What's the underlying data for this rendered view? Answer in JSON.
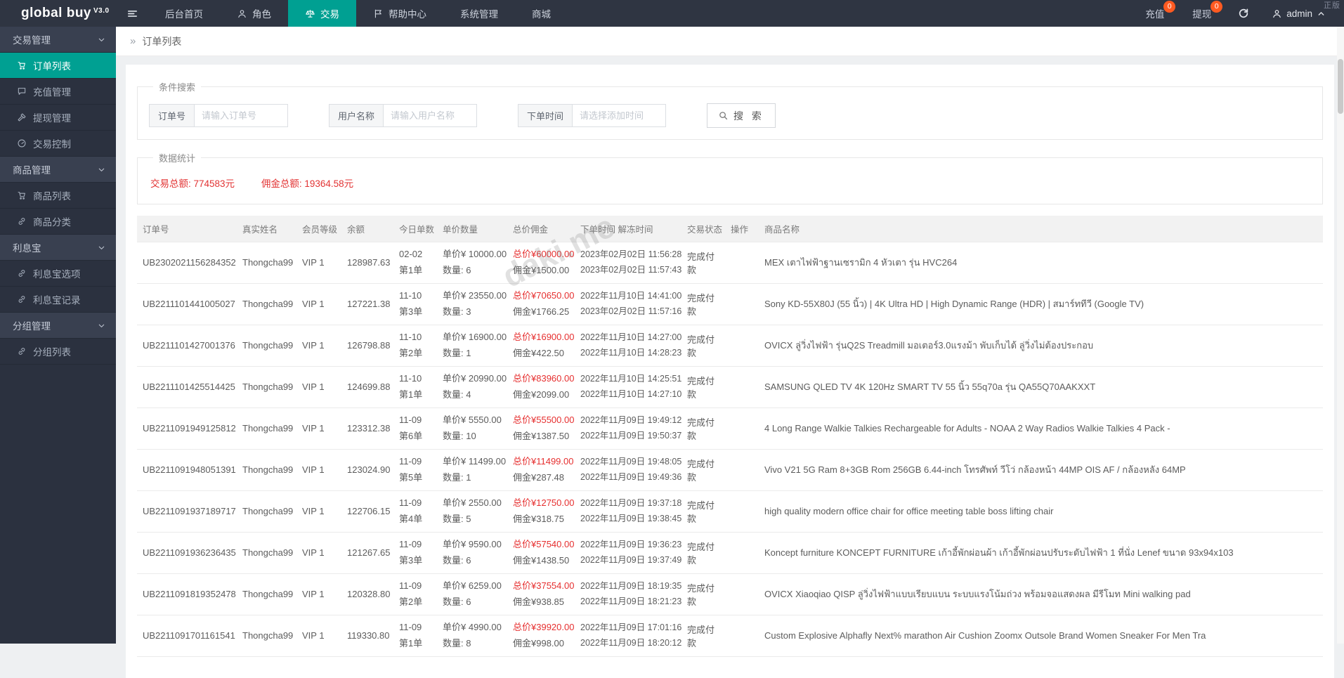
{
  "navbar": {
    "logo": "global buy",
    "logo_version": "V3.0",
    "menu": [
      {
        "label": "后台首页",
        "icon": null,
        "active": false
      },
      {
        "label": "角色",
        "icon": "person",
        "active": false
      },
      {
        "label": "交易",
        "icon": "scales",
        "active": true
      },
      {
        "label": "帮助中心",
        "icon": "flag",
        "active": false
      },
      {
        "label": "系统管理",
        "icon": null,
        "active": false
      },
      {
        "label": "商城",
        "icon": null,
        "active": false
      }
    ],
    "right": {
      "recharge_label": "充值",
      "recharge_badge": "0",
      "withdraw_label": "提现",
      "withdraw_badge": "0",
      "user": "admin",
      "corner_tag": "正版"
    }
  },
  "sidebar": {
    "groups": [
      {
        "label": "交易管理",
        "items": [
          {
            "label": "订单列表",
            "icon": "cart",
            "active": true
          },
          {
            "label": "充值管理",
            "icon": "comment",
            "active": false
          },
          {
            "label": "提现管理",
            "icon": "gavel",
            "active": false
          },
          {
            "label": "交易控制",
            "icon": "gauge",
            "active": false
          }
        ]
      },
      {
        "label": "商品管理",
        "items": [
          {
            "label": "商品列表",
            "icon": "cart",
            "active": false
          },
          {
            "label": "商品分类",
            "icon": "link",
            "active": false
          }
        ]
      },
      {
        "label": "利息宝",
        "items": [
          {
            "label": "利息宝选项",
            "icon": "link",
            "active": false
          },
          {
            "label": "利息宝记录",
            "icon": "link",
            "active": false
          }
        ]
      },
      {
        "label": "分组管理",
        "items": [
          {
            "label": "分组列表",
            "icon": "link",
            "active": false
          }
        ]
      }
    ]
  },
  "breadcrumb": {
    "title": "订单列表"
  },
  "search": {
    "legend": "条件搜索",
    "fields": [
      {
        "label": "订单号",
        "placeholder": "请输入订单号"
      },
      {
        "label": "用户名称",
        "placeholder": "请输入用户名称"
      },
      {
        "label": "下单时间",
        "placeholder": "请选择添加时间"
      }
    ],
    "button": "搜 索"
  },
  "stats": {
    "legend": "数据统计",
    "total_trade": "交易总额: 774583元",
    "total_commission": "佣金总额: 19364.58元"
  },
  "watermark": "daki.me",
  "table": {
    "headers": [
      "订单号",
      "真实姓名",
      "会员等级",
      "余额",
      "今日单数",
      "单价数量",
      "总价佣金",
      "下单时间 解冻时间",
      "交易状态",
      "操作",
      "商品名称"
    ],
    "rows": [
      {
        "order_no": "UB2302021156284352",
        "real_name": "Thongcha99",
        "vip": "VIP 1",
        "balance": "128987.63",
        "day": "02-02",
        "seq": "第1单",
        "unit_price": "单价¥ 10000.00",
        "quantity": "数量: 6",
        "total": "总价¥60000.00",
        "commission": "佣金¥1500.00",
        "order_time": "2023年02月02日 11:56:28",
        "unfreeze_time": "2023年02月02日 11:57:43",
        "status": "完成付款",
        "product": "MEX เตาไฟฟ้าฐานเซรามิก 4 หัวเตา รุ่น HVC264"
      },
      {
        "order_no": "UB2211101441005027",
        "real_name": "Thongcha99",
        "vip": "VIP 1",
        "balance": "127221.38",
        "day": "11-10",
        "seq": "第3单",
        "unit_price": "单价¥ 23550.00",
        "quantity": "数量: 3",
        "total": "总价¥70650.00",
        "commission": "佣金¥1766.25",
        "order_time": "2022年11月10日 14:41:00",
        "unfreeze_time": "2023年02月02日 11:57:16",
        "status": "完成付款",
        "product": "Sony KD-55X80J (55 นิ้ว) | 4K Ultra HD | High Dynamic Range (HDR) | สมาร์ททีวี (Google TV)"
      },
      {
        "order_no": "UB2211101427001376",
        "real_name": "Thongcha99",
        "vip": "VIP 1",
        "balance": "126798.88",
        "day": "11-10",
        "seq": "第2单",
        "unit_price": "单价¥ 16900.00",
        "quantity": "数量: 1",
        "total": "总价¥16900.00",
        "commission": "佣金¥422.50",
        "order_time": "2022年11月10日 14:27:00",
        "unfreeze_time": "2022年11月10日 14:28:23",
        "status": "完成付款",
        "product": "OVICX ลู่วิ่งไฟฟ้า รุ่นQ2S Treadmill มอเตอร์3.0แรงม้า พับเก็บได้ ลู่วิ่งไม่ต้องประกอบ"
      },
      {
        "order_no": "UB2211101425514425",
        "real_name": "Thongcha99",
        "vip": "VIP 1",
        "balance": "124699.88",
        "day": "11-10",
        "seq": "第1单",
        "unit_price": "单价¥ 20990.00",
        "quantity": "数量: 4",
        "total": "总价¥83960.00",
        "commission": "佣金¥2099.00",
        "order_time": "2022年11月10日 14:25:51",
        "unfreeze_time": "2022年11月10日 14:27:10",
        "status": "完成付款",
        "product": "SAMSUNG QLED TV 4K 120Hz SMART TV 55 นิ้ว 55q70a รุ่น QA55Q70AAKXXT"
      },
      {
        "order_no": "UB2211091949125812",
        "real_name": "Thongcha99",
        "vip": "VIP 1",
        "balance": "123312.38",
        "day": "11-09",
        "seq": "第6单",
        "unit_price": "单价¥ 5550.00",
        "quantity": "数量: 10",
        "total": "总价¥55500.00",
        "commission": "佣金¥1387.50",
        "order_time": "2022年11月09日 19:49:12",
        "unfreeze_time": "2022年11月09日 19:50:37",
        "status": "完成付款",
        "product": "4 Long Range Walkie Talkies Rechargeable for Adults - NOAA 2 Way Radios Walkie Talkies 4 Pack -"
      },
      {
        "order_no": "UB2211091948051391",
        "real_name": "Thongcha99",
        "vip": "VIP 1",
        "balance": "123024.90",
        "day": "11-09",
        "seq": "第5单",
        "unit_price": "单价¥ 11499.00",
        "quantity": "数量: 1",
        "total": "总价¥11499.00",
        "commission": "佣金¥287.48",
        "order_time": "2022年11月09日 19:48:05",
        "unfreeze_time": "2022年11月09日 19:49:36",
        "status": "完成付款",
        "product": "Vivo V21 5G Ram 8+3GB Rom 256GB 6.44-inch โทรศัพท์ วีโว่ กล้องหน้า 44MP OIS AF / กล้องหลัง 64MP"
      },
      {
        "order_no": "UB2211091937189717",
        "real_name": "Thongcha99",
        "vip": "VIP 1",
        "balance": "122706.15",
        "day": "11-09",
        "seq": "第4单",
        "unit_price": "单价¥ 2550.00",
        "quantity": "数量: 5",
        "total": "总价¥12750.00",
        "commission": "佣金¥318.75",
        "order_time": "2022年11月09日 19:37:18",
        "unfreeze_time": "2022年11月09日 19:38:45",
        "status": "完成付款",
        "product": "high quality modern office chair for office meeting table boss lifting chair"
      },
      {
        "order_no": "UB2211091936236435",
        "real_name": "Thongcha99",
        "vip": "VIP 1",
        "balance": "121267.65",
        "day": "11-09",
        "seq": "第3单",
        "unit_price": "单价¥ 9590.00",
        "quantity": "数量: 6",
        "total": "总价¥57540.00",
        "commission": "佣金¥1438.50",
        "order_time": "2022年11月09日 19:36:23",
        "unfreeze_time": "2022年11月09日 19:37:49",
        "status": "完成付款",
        "product": "Koncept furniture KONCEPT FURNITURE เก้าอี้พักผ่อนผ้า เก้าอี้พักผ่อนปรับระดับไฟฟ้า 1 ที่นั่ง Lenef ขนาด 93x94x103"
      },
      {
        "order_no": "UB2211091819352478",
        "real_name": "Thongcha99",
        "vip": "VIP 1",
        "balance": "120328.80",
        "day": "11-09",
        "seq": "第2单",
        "unit_price": "单价¥ 6259.00",
        "quantity": "数量: 6",
        "total": "总价¥37554.00",
        "commission": "佣金¥938.85",
        "order_time": "2022年11月09日 18:19:35",
        "unfreeze_time": "2022年11月09日 18:21:23",
        "status": "完成付款",
        "product": "OVICX Xiaoqiao QISP ลู่วิ่งไฟฟ้าแบบเรียบแบน ระบบแรงโน้มถ่วง พร้อมจอแสดงผล มีรีโมท Mini walking pad"
      },
      {
        "order_no": "UB2211091701161541",
        "real_name": "Thongcha99",
        "vip": "VIP 1",
        "balance": "119330.80",
        "day": "11-09",
        "seq": "第1单",
        "unit_price": "单价¥ 4990.00",
        "quantity": "数量: 8",
        "total": "总价¥39920.00",
        "commission": "佣金¥998.00",
        "order_time": "2022年11月09日 17:01:16",
        "unfreeze_time": "2022年11月09日 18:20:12",
        "status": "完成付款",
        "product": "Custom Explosive Alphafly Next% marathon Air Cushion Zoomx Outsole Brand Women Sneaker For Men Tra"
      }
    ]
  }
}
